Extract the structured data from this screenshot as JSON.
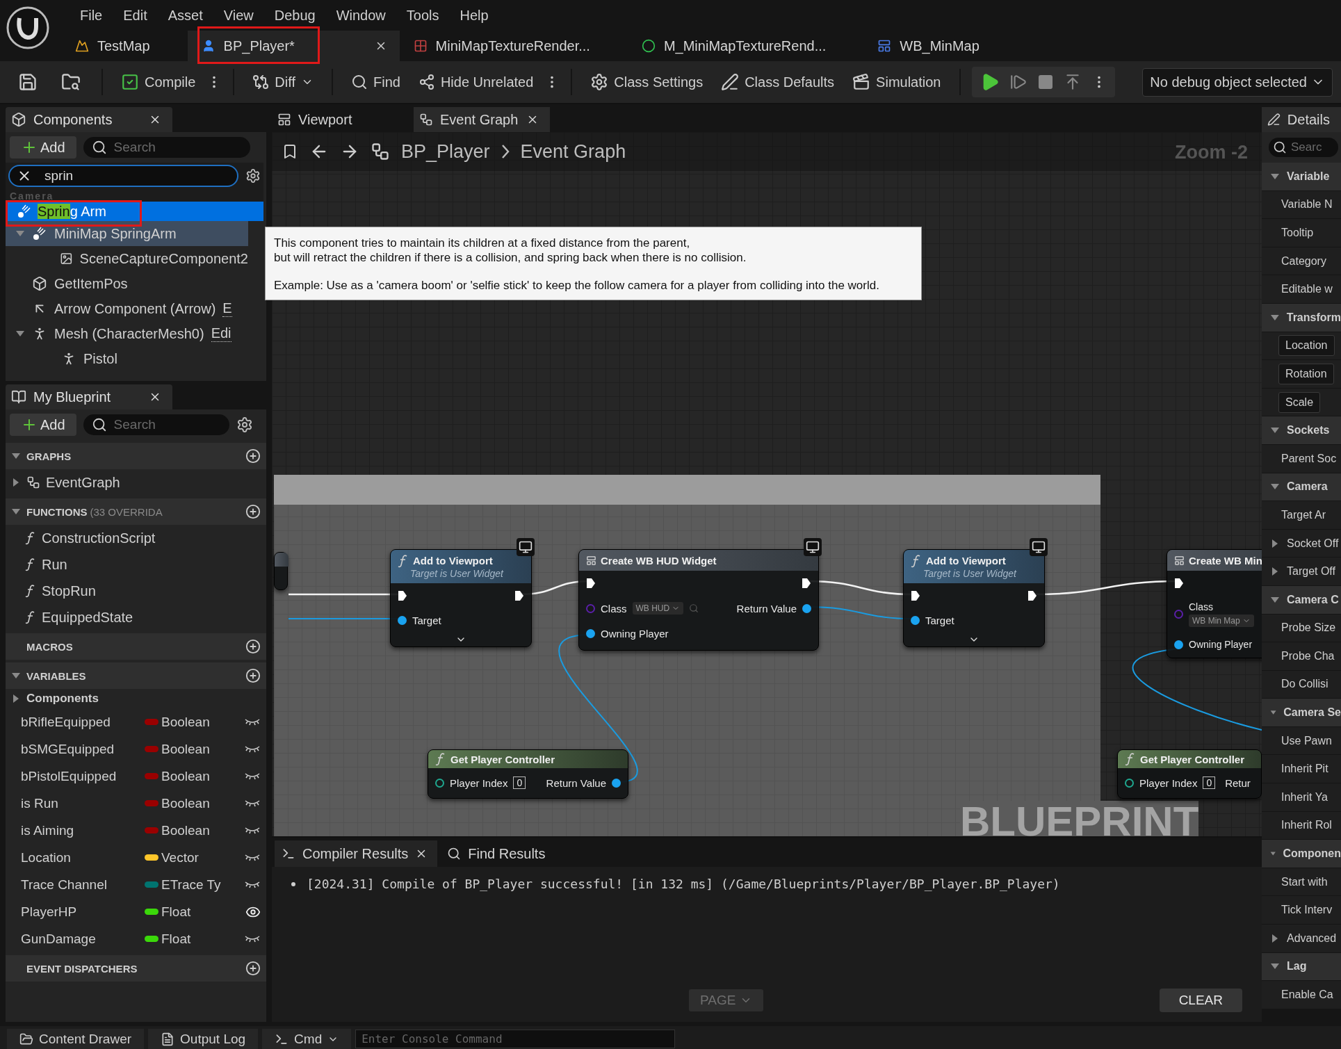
{
  "menu": [
    "File",
    "Edit",
    "Asset",
    "View",
    "Debug",
    "Window",
    "Tools",
    "Help"
  ],
  "document_tabs": [
    {
      "label": "TestMap",
      "kind": "map",
      "selected": false,
      "outlined": false
    },
    {
      "label": "BP_Player*",
      "kind": "blueprint",
      "selected": true,
      "outlined": true
    },
    {
      "label": "MiniMapTextureRender...",
      "kind": "texture",
      "selected": false,
      "outlined": false
    },
    {
      "label": "M_MiniMapTextureRend...",
      "kind": "material",
      "selected": false,
      "outlined": false
    },
    {
      "label": "WB_MinMap",
      "kind": "widget",
      "selected": false,
      "outlined": false
    }
  ],
  "toolbar": {
    "compile": "Compile",
    "diff": "Diff",
    "find": "Find",
    "hide_unrelated": "Hide Unrelated",
    "class_settings": "Class Settings",
    "class_defaults": "Class Defaults",
    "simulation": "Simulation",
    "debug_object": "No debug object selected"
  },
  "components_panel": {
    "title": "Components",
    "add": "Add",
    "search_placeholder": "Search",
    "filter": {
      "value": "sprin",
      "category": "Camera",
      "results": [
        {
          "match": "Sprin",
          "rest": "g Arm",
          "selected": true,
          "outlined": true
        }
      ]
    },
    "tree": [
      {
        "label": "MiniMap SpringArm",
        "kind": "spring",
        "selected": true,
        "expanded": true,
        "children": [
          {
            "label": "SceneCaptureComponent2",
            "kind": "capture",
            "selected": false
          }
        ]
      },
      {
        "label": "GetItemPos",
        "kind": "box",
        "selected": false
      },
      {
        "label": "Arrow Component (Arrow)",
        "kind": "arrow",
        "link": "E",
        "selected": false
      },
      {
        "label": "Mesh (CharacterMesh0)",
        "kind": "skeleton",
        "link": "Edi",
        "selected": false,
        "expanded": true,
        "children": [
          {
            "label": "Pistol",
            "kind": "skeleton",
            "selected": false
          }
        ]
      }
    ]
  },
  "my_blueprint": {
    "title": "My Blueprint",
    "add": "Add",
    "search_placeholder": "Search",
    "sections": [
      {
        "title": "GRAPHS",
        "kind": "collapsible",
        "expanded": true,
        "items": [
          {
            "kind": "graph",
            "label": "EventGraph",
            "expanded": false
          }
        ]
      },
      {
        "title": "FUNCTIONS",
        "note": "(33 OVERRIDA",
        "kind": "collapsible",
        "expanded": true,
        "items": [
          {
            "kind": "construction",
            "label": "ConstructionScript"
          },
          {
            "kind": "function",
            "label": "Run"
          },
          {
            "kind": "function",
            "label": "StopRun"
          },
          {
            "kind": "function",
            "label": "EquippedState"
          }
        ]
      },
      {
        "title": "MACROS",
        "kind": "plain"
      },
      {
        "title": "VARIABLES",
        "kind": "collapsible",
        "expanded": true,
        "items": [
          {
            "kind": "category",
            "label": "Components",
            "expanded": false
          },
          {
            "kind": "variable",
            "label": "bRifleEquipped",
            "type": "Boolean",
            "color": "#9a0000",
            "visible": false
          },
          {
            "kind": "variable",
            "label": "bSMGEquipped",
            "type": "Boolean",
            "color": "#9a0000",
            "visible": false
          },
          {
            "kind": "variable",
            "label": "bPistolEquipped",
            "type": "Boolean",
            "color": "#9a0000",
            "visible": false
          },
          {
            "kind": "variable",
            "label": "is Run",
            "type": "Boolean",
            "color": "#9a0000",
            "visible": false
          },
          {
            "kind": "variable",
            "label": "is Aiming",
            "type": "Boolean",
            "color": "#9a0000",
            "visible": false
          },
          {
            "kind": "variable",
            "label": "Location",
            "type": "Vector",
            "color": "#fdc62a",
            "visible": false
          },
          {
            "kind": "variable",
            "label": "Trace Channel",
            "type": "ETrace Ty",
            "color": "#007470",
            "visible": false
          },
          {
            "kind": "variable",
            "label": "PlayerHP",
            "type": "Float",
            "color": "#3bd80a",
            "visible": true
          },
          {
            "kind": "variable",
            "label": "GunDamage",
            "type": "Float",
            "color": "#3bd80a",
            "visible": false
          }
        ]
      },
      {
        "title": "EVENT DISPATCHERS",
        "kind": "plain"
      }
    ]
  },
  "graph_editor": {
    "tabs": [
      {
        "label": "Viewport",
        "kind": "viewport",
        "selected": false
      },
      {
        "label": "Event Graph",
        "kind": "graph",
        "selected": true
      }
    ],
    "breadcrumb": [
      "BP_Player",
      "Event Graph"
    ],
    "zoom": "Zoom -2",
    "watermark": "BLUEPRINT",
    "tooltip": {
      "text": "This component tries to maintain its children at a fixed distance from the parent,\nbut will retract the children if there is a collision, and spring back when there is no collision.",
      "example": "Example: Use as a 'camera boom' or 'selfie stick' to keep the follow camera for a player from colliding into the world."
    },
    "nodes": [
      {
        "kind": "stub"
      },
      {
        "kind": "call",
        "title": "Add to Viewport",
        "subtitle": "Target is User Widget",
        "pin": "Target"
      },
      {
        "kind": "create",
        "title": "Create WB HUD Widget",
        "class_label": "Class",
        "class_value": "WB HUD",
        "owner_label": "Owning Player",
        "return_label": "Return Value"
      },
      {
        "kind": "call",
        "title": "Add to Viewport",
        "subtitle": "Target is User Widget",
        "pin": "Target"
      },
      {
        "kind": "create",
        "title": "Create WB Min",
        "class_label": "Class",
        "class_value": "WB Min Map",
        "owner_label": "Owning Player"
      },
      {
        "kind": "pure",
        "title": "Get Player Controller",
        "index_label": "Player Index",
        "index_value": "0",
        "return_label": "Return Value"
      },
      {
        "kind": "pure",
        "title": "Get Player Controller",
        "index_label": "Player Index",
        "index_value": "0",
        "return_label": "Retur"
      }
    ]
  },
  "compiler": {
    "tabs": [
      {
        "label": "Compiler Results",
        "kind": "results",
        "selected": true
      },
      {
        "label": "Find Results",
        "kind": "find",
        "selected": false
      }
    ],
    "messages": [
      "[2024.31] Compile of BP_Player successful! [in 132 ms] (/Game/Blueprints/Player/BP_Player.BP_Player)"
    ],
    "page": "PAGE",
    "clear": "CLEAR"
  },
  "details": {
    "title": "Details",
    "search_placeholder": "Searc",
    "rows": [
      {
        "kind": "section",
        "label": "Variable",
        "expanded": true
      },
      {
        "kind": "property",
        "label": "Variable N"
      },
      {
        "kind": "property",
        "label": "Tooltip"
      },
      {
        "kind": "property",
        "label": "Category"
      },
      {
        "kind": "property",
        "label": "Editable w"
      },
      {
        "kind": "section",
        "label": "Transform",
        "expanded": true
      },
      {
        "kind": "boxed",
        "label": "Location"
      },
      {
        "kind": "boxed",
        "label": "Rotation"
      },
      {
        "kind": "boxed",
        "label": "Scale"
      },
      {
        "kind": "section",
        "label": "Sockets",
        "expanded": true
      },
      {
        "kind": "property",
        "label": "Parent Soc"
      },
      {
        "kind": "section",
        "label": "Camera",
        "expanded": true
      },
      {
        "kind": "property",
        "label": "Target Ar"
      },
      {
        "kind": "group",
        "label": "Socket Off",
        "expanded": false
      },
      {
        "kind": "group",
        "label": "Target Off",
        "expanded": false
      },
      {
        "kind": "section",
        "label": "Camera C",
        "expanded": true
      },
      {
        "kind": "property",
        "label": "Probe Size"
      },
      {
        "kind": "property",
        "label": "Probe Cha"
      },
      {
        "kind": "property",
        "label": "Do Collisi"
      },
      {
        "kind": "section",
        "label": "Camera Se",
        "expanded": true
      },
      {
        "kind": "property",
        "label": "Use Pawn"
      },
      {
        "kind": "property",
        "label": "Inherit Pit"
      },
      {
        "kind": "property",
        "label": "Inherit Ya"
      },
      {
        "kind": "property",
        "label": "Inherit Rol"
      },
      {
        "kind": "section",
        "label": "Componen",
        "expanded": true
      },
      {
        "kind": "property",
        "label": "Start with"
      },
      {
        "kind": "property",
        "label": "Tick Interv"
      },
      {
        "kind": "group",
        "label": "Advanced",
        "expanded": false
      },
      {
        "kind": "section",
        "label": "Lag",
        "expanded": true
      },
      {
        "kind": "property",
        "label": "Enable Ca"
      }
    ]
  },
  "status_bar": {
    "content_drawer": "Content Drawer",
    "output_log": "Output Log",
    "cmd": "Cmd",
    "console_placeholder": "Enter Console Command"
  }
}
